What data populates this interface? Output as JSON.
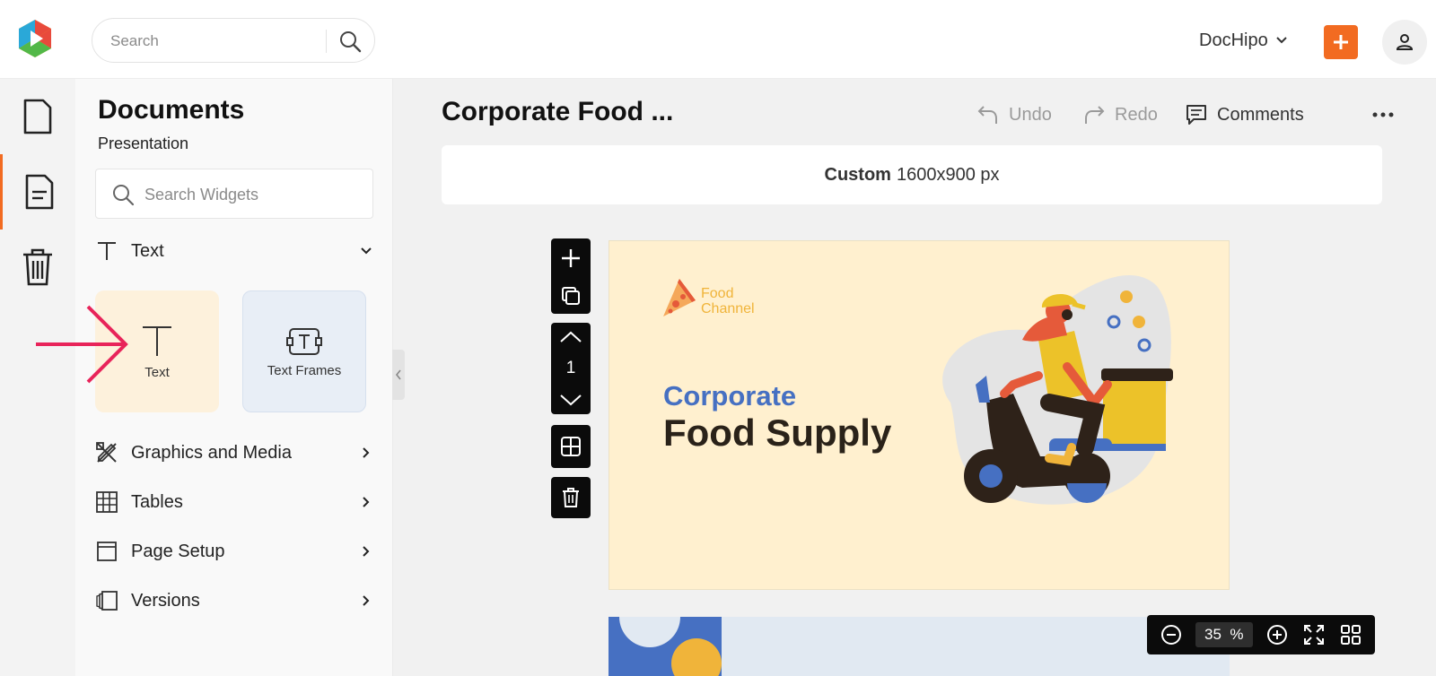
{
  "header": {
    "search_placeholder": "Search",
    "account_name": "DocHipo",
    "brand_colors": {
      "orange": "#f26b21"
    }
  },
  "rail": {
    "items": [
      {
        "name": "documents",
        "active": false
      },
      {
        "name": "templates",
        "active": true
      },
      {
        "name": "trash",
        "active": false
      }
    ]
  },
  "panel": {
    "title": "Documents",
    "subtitle": "Presentation",
    "widget_search_placeholder": "Search Widgets",
    "text_section": {
      "label": "Text",
      "expanded": true
    },
    "tiles": [
      {
        "label": "Text"
      },
      {
        "label": "Text Frames"
      }
    ],
    "sections": [
      {
        "label": "Graphics and Media"
      },
      {
        "label": "Tables"
      },
      {
        "label": "Page Setup"
      },
      {
        "label": "Versions"
      }
    ]
  },
  "editor": {
    "doc_title": "Corporate Food ...",
    "undo_label": "Undo",
    "redo_label": "Redo",
    "comments_label": "Comments",
    "size_type": "Custom",
    "size_value": "1600x900 px",
    "page_number": "1",
    "zoom_value": "35",
    "zoom_unit": "%"
  },
  "slide": {
    "brand_line1": "Food",
    "brand_line2": "Channel",
    "heading_small": "Corporate",
    "heading_large": "Food Supply"
  }
}
